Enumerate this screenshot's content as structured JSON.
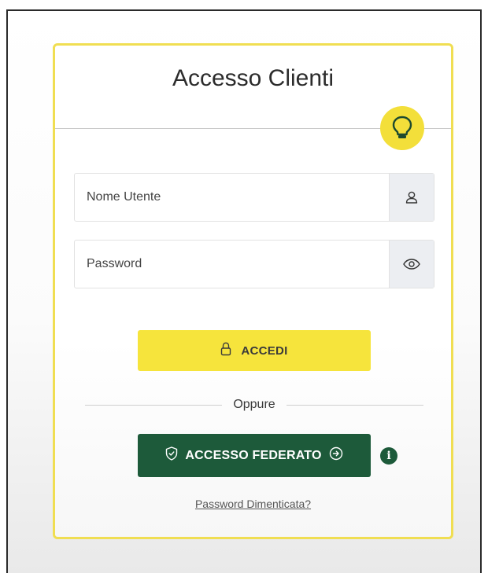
{
  "card": {
    "title": "Accesso Clienti",
    "username_placeholder": "Nome Utente",
    "password_placeholder": "Password",
    "login_button": "ACCEDI",
    "divider_text": "Oppure",
    "federated_button": "ACCESSO FEDERATO",
    "forgot_link": "Password Dimenticata?"
  },
  "icons": {
    "bulb": "lightbulb-icon",
    "username_addon": "user-icon",
    "password_addon": "eye-icon",
    "login": "lock-icon",
    "federated_left": "shield-icon",
    "federated_right": "arrow-right-circle-icon",
    "info": "info-icon"
  },
  "colors": {
    "accent_yellow": "#f6e43c",
    "card_border": "#f0de52",
    "federated_green": "#1d5a3a"
  }
}
